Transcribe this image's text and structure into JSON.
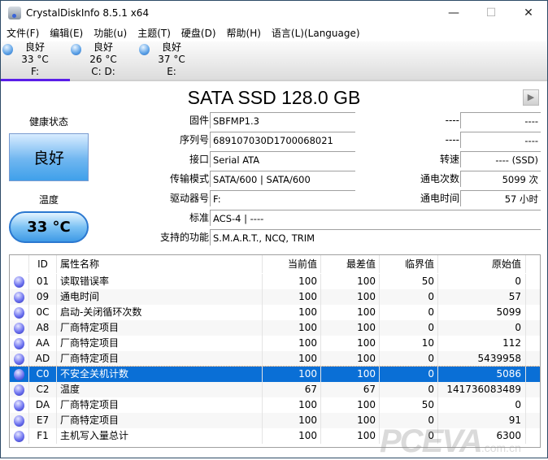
{
  "window": {
    "title": "CrystalDiskInfo 8.5.1 x64",
    "minimize": "—",
    "maximize": "☐",
    "close": "✕"
  },
  "menu": [
    "文件(F)",
    "编辑(E)",
    "功能(u)",
    "主题(T)",
    "硬盘(D)",
    "帮助(H)",
    "语言(L)(Language)"
  ],
  "disks": [
    {
      "status": "良好",
      "temp": "33 °C",
      "drive": "F:",
      "active": true
    },
    {
      "status": "良好",
      "temp": "26 °C",
      "drive": "C: D:"
    },
    {
      "status": "良好",
      "temp": "37 °C",
      "drive": "E:"
    }
  ],
  "model": "SATA SSD 128.0 GB",
  "health": {
    "label": "健康状态",
    "value": "良好",
    "color": "#4aa8ec"
  },
  "temperature": {
    "label": "温度",
    "value": "33 °C"
  },
  "info": {
    "firmware": {
      "label": "固件",
      "value": "SBFMP1.3"
    },
    "serial": {
      "label": "序列号",
      "value": "689107030D1700068021"
    },
    "interface": {
      "label": "接口",
      "value": "Serial ATA"
    },
    "transfer": {
      "label": "传输模式",
      "value": "SATA/600 | SATA/600"
    },
    "drive_letter": {
      "label": "驱动器号",
      "value": "F:"
    },
    "standard": {
      "label": "标准",
      "value": "ACS-4 | ----"
    },
    "features": {
      "label": "支持的功能",
      "value": "S.M.A.R.T., NCQ, TRIM"
    },
    "r1": {
      "label": "----",
      "value": "----"
    },
    "r2": {
      "label": "----",
      "value": "----"
    },
    "rotation": {
      "label": "转速",
      "value": "---- (SSD)"
    },
    "power_count": {
      "label": "通电次数",
      "value": "5099 次"
    },
    "power_hours": {
      "label": "通电时间",
      "value": "57 小时"
    }
  },
  "smart": {
    "headers": [
      "ID",
      "属性名称",
      "当前值",
      "最差值",
      "临界值",
      "原始值"
    ],
    "rows": [
      [
        "01",
        "读取错误率",
        "100",
        "100",
        "50",
        "0"
      ],
      [
        "09",
        "通电时间",
        "100",
        "100",
        "0",
        "57"
      ],
      [
        "0C",
        "启动-关闭循环次数",
        "100",
        "100",
        "0",
        "5099"
      ],
      [
        "A8",
        "厂商特定项目",
        "100",
        "100",
        "0",
        "0"
      ],
      [
        "AA",
        "厂商特定项目",
        "100",
        "100",
        "10",
        "112"
      ],
      [
        "AD",
        "厂商特定项目",
        "100",
        "100",
        "0",
        "5439958"
      ],
      [
        "C0",
        "不安全关机计数",
        "100",
        "100",
        "0",
        "5086"
      ],
      [
        "C2",
        "温度",
        "67",
        "67",
        "0",
        "141736083489"
      ],
      [
        "DA",
        "厂商特定项目",
        "100",
        "100",
        "50",
        "0"
      ],
      [
        "E7",
        "厂商特定项目",
        "100",
        "100",
        "0",
        "91"
      ],
      [
        "F1",
        "主机写入量总计",
        "100",
        "100",
        "0",
        "6300"
      ]
    ],
    "selected_index": 6
  },
  "watermark": {
    "text": "PCEVA",
    ".suffix": ".com.cn"
  }
}
